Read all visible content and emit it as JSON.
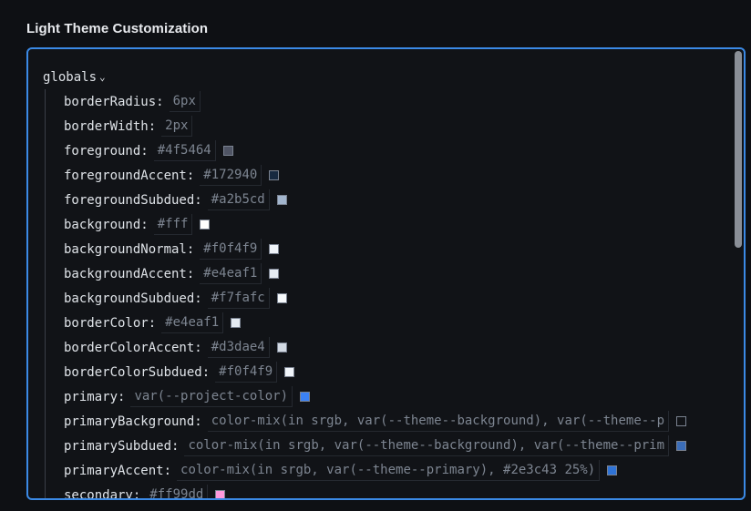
{
  "section_title": "Light Theme Customization",
  "tree": {
    "root_key": "globals",
    "entries": [
      {
        "key": "borderRadius",
        "value": "6px"
      },
      {
        "key": "borderWidth",
        "value": "2px"
      },
      {
        "key": "foreground",
        "value": "#4f5464",
        "swatch": "#4f5464"
      },
      {
        "key": "foregroundAccent",
        "value": "#172940",
        "swatch": "#172940"
      },
      {
        "key": "foregroundSubdued",
        "value": "#a2b5cd",
        "swatch": "#a2b5cd"
      },
      {
        "key": "background",
        "value": "#fff",
        "swatch": "#ffffff"
      },
      {
        "key": "backgroundNormal",
        "value": "#f0f4f9",
        "swatch": "#f0f4f9"
      },
      {
        "key": "backgroundAccent",
        "value": "#e4eaf1",
        "swatch": "#e4eaf1"
      },
      {
        "key": "backgroundSubdued",
        "value": "#f7fafc",
        "swatch": "#f7fafc"
      },
      {
        "key": "borderColor",
        "value": "#e4eaf1",
        "swatch": "#e4eaf1"
      },
      {
        "key": "borderColorAccent",
        "value": "#d3dae4",
        "swatch": "#d3dae4"
      },
      {
        "key": "borderColorSubdued",
        "value": "#f0f4f9",
        "swatch": "#f0f4f9"
      },
      {
        "key": "primary",
        "value": "var(--project-color)",
        "swatch": "#3b82f6"
      },
      {
        "key": "primaryBackground",
        "value": "color-mix(in srgb, var(--theme--background), var(--theme--p",
        "swatch": "#111317",
        "clip": true
      },
      {
        "key": "primarySubdued",
        "value": "color-mix(in srgb, var(--theme--background), var(--theme--prim",
        "swatch": "#3b6db8",
        "clip": true
      },
      {
        "key": "primaryAccent",
        "value": "color-mix(in srgb, var(--theme--primary), #2e3c43 25%)",
        "swatch": "#2f73d6"
      },
      {
        "key": "secondary",
        "value": "#ff99dd",
        "swatch": "#ff99dd"
      }
    ]
  },
  "colors": {
    "accent_border": "#3b8ae6"
  }
}
